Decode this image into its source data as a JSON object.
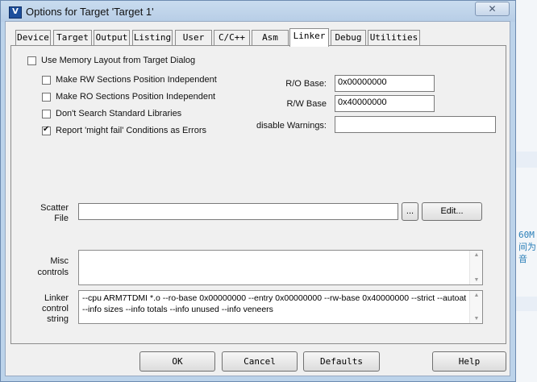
{
  "window": {
    "title": "Options for Target 'Target 1'",
    "close_glyph": "✕"
  },
  "tabs": [
    {
      "label": "Device"
    },
    {
      "label": "Target"
    },
    {
      "label": "Output"
    },
    {
      "label": "Listing"
    },
    {
      "label": "User"
    },
    {
      "label": "C/C++"
    },
    {
      "label": "Asm"
    },
    {
      "label": "Linker",
      "active": true
    },
    {
      "label": "Debug"
    },
    {
      "label": "Utilities"
    }
  ],
  "linker": {
    "use_memory_layout": {
      "label": "Use Memory Layout from Target Dialog",
      "checked": false
    },
    "options": [
      {
        "label": "Make RW Sections Position Independent",
        "checked": false
      },
      {
        "label": "Make RO Sections Position Independent",
        "checked": false
      },
      {
        "label": "Don't Search Standard Libraries",
        "checked": false
      },
      {
        "label": "Report 'might fail' Conditions as Errors",
        "checked": true
      }
    ],
    "ro_base": {
      "label": "R/O Base:",
      "value": "0x00000000"
    },
    "rw_base": {
      "label": "R/W Base",
      "value": "0x40000000"
    },
    "disable_warnings": {
      "label": "disable Warnings:",
      "value": ""
    },
    "scatter": {
      "label_line1": "Scatter",
      "label_line2": "File",
      "value": "",
      "browse_label": "...",
      "edit_label": "Edit..."
    },
    "misc": {
      "label_line1": "Misc",
      "label_line2": "controls",
      "value": ""
    },
    "control_string": {
      "label_line1": "Linker",
      "label_line2": "control",
      "label_line3": "string",
      "line1": "--cpu ARM7TDMI *.o --ro-base 0x00000000 --entry 0x00000000 --rw-base 0x40000000 --strict --autoat",
      "line2": "--info sizes --info totals --info unused --info veneers"
    }
  },
  "buttons": {
    "ok": "OK",
    "cancel": "Cancel",
    "defaults": "Defaults",
    "help": "Help"
  },
  "background": {
    "line1": "60M",
    "line2": "间为",
    "line3": "音"
  }
}
